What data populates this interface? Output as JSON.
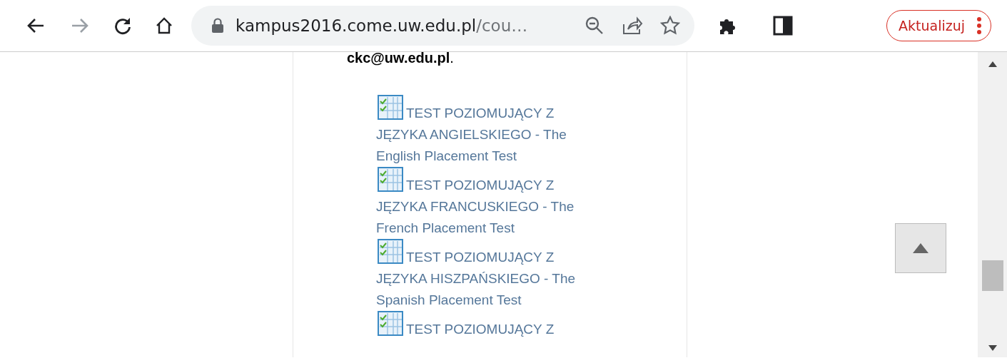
{
  "browser": {
    "back_enabled": true,
    "forward_enabled": false,
    "url_host": "kampus2016.come.uw.edu.pl",
    "url_rest": "/cou…",
    "update_button": "Aktualizuj"
  },
  "content": {
    "email_line": "**ckc@uw.edu.pl**.",
    "links": [
      {
        "text": "TEST POZIOMUJĄCY Z JĘZYKA ANGIELSKIEGO - The English Placement Test"
      },
      {
        "text": "TEST POZIOMUJĄCY Z JĘZYKA FRANCUSKIEGO - The French Placement Test"
      },
      {
        "text": "TEST POZIOMUJĄCY Z JĘZYKA HISZPAŃSKIEGO - The Spanish Placement Test"
      },
      {
        "text": "TEST POZIOMUJĄCY Z"
      }
    ]
  }
}
